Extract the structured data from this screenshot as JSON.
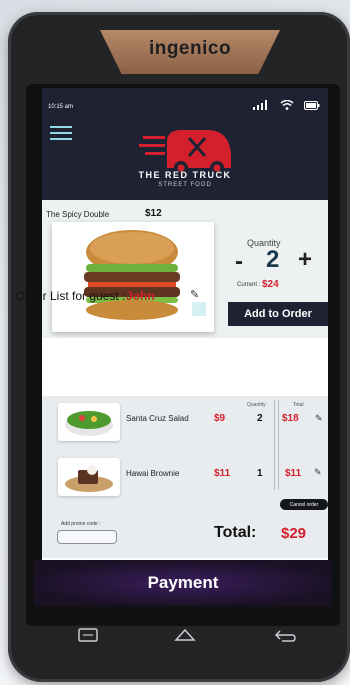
{
  "device": {
    "brand": "ingenico"
  },
  "status": {
    "time": "10:15 am"
  },
  "app": {
    "logo_title": "THE RED TRUCK",
    "logo_subtitle": "STREET FOOD"
  },
  "product": {
    "name": "The Spicy Double",
    "price": "$12",
    "quantity_label": "Quantity",
    "minus_label": "-",
    "quantity": "2",
    "plus_label": "+",
    "current_label": "Current :",
    "current_value": "$24",
    "add_button": "Add to Order"
  },
  "order": {
    "title": "Order List for guest :",
    "guest": "John",
    "columns": {
      "quantity": "Quantity",
      "total": "Total"
    },
    "items": [
      {
        "name": "Santa Cruz Salad",
        "price": "$9",
        "quantity": "2",
        "total": "$18"
      },
      {
        "name": "Hawai Brownie",
        "price": "$11",
        "quantity": "1",
        "total": "$11"
      }
    ],
    "cancel_button": "Cancel order",
    "promo_label": "Add promo code :",
    "promo_value": "",
    "total_label": "Total:",
    "total_value": "$29"
  },
  "payment": {
    "label": "Payment"
  },
  "colors": {
    "header": "#1f2233",
    "accent": "#d4202c",
    "panel": "#edf1f2",
    "payment": "#2d1846"
  },
  "icons": [
    "menu-icon",
    "signal-icon",
    "wifi-icon",
    "battery-icon",
    "edit-icon",
    "recent-apps-icon",
    "home-icon",
    "back-icon"
  ]
}
